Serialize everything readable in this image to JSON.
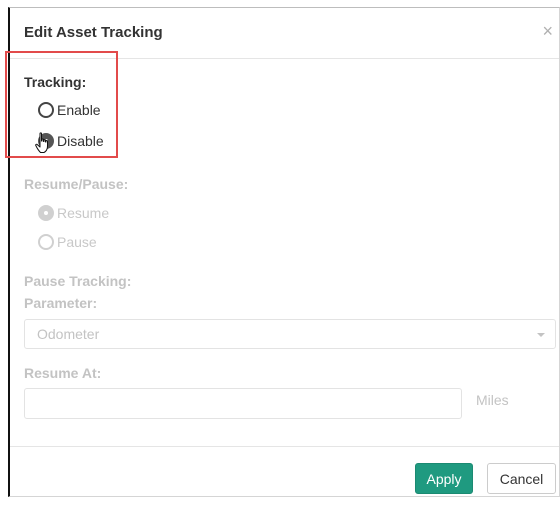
{
  "dialog": {
    "title": "Edit Asset Tracking",
    "close_symbol": "×"
  },
  "tracking": {
    "label": "Tracking:",
    "options": [
      {
        "label": "Enable",
        "checked": false
      },
      {
        "label": "Disable",
        "checked": true
      }
    ]
  },
  "resume_pause": {
    "label": "Resume/Pause:",
    "options": [
      {
        "label": "Resume",
        "checked": true
      },
      {
        "label": "Pause",
        "checked": false
      }
    ]
  },
  "pause_tracking": {
    "label": "Pause Tracking:",
    "parameter_label": "Parameter:",
    "parameter_value": "Odometer",
    "resume_at_label": "Resume At:",
    "resume_at_value": "",
    "units": "Miles"
  },
  "footer": {
    "apply_label": "Apply",
    "cancel_label": "Cancel"
  },
  "colors": {
    "highlight": "#e24b4b",
    "apply": "#1f9a80"
  },
  "icons": {
    "close": "close-icon",
    "cursor": "hand-pointer-icon",
    "caret": "chevron-down-icon"
  }
}
